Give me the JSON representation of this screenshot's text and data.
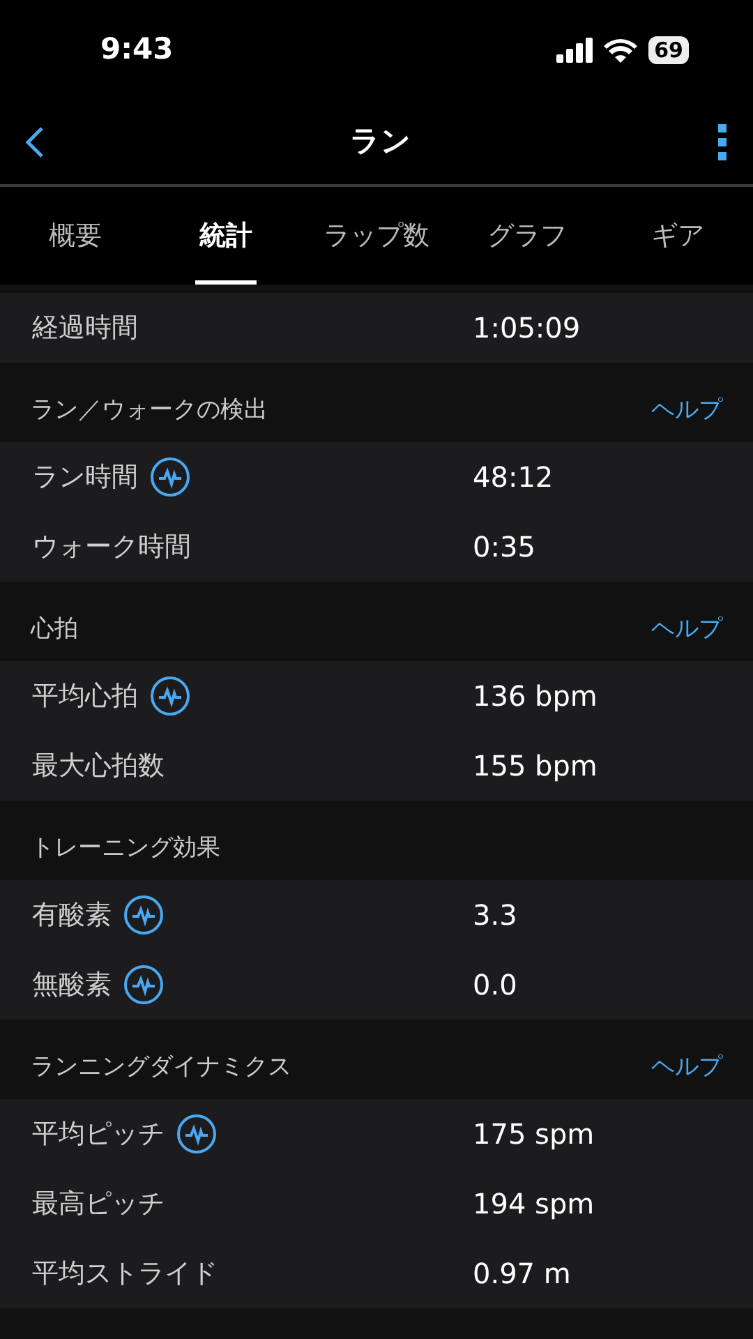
{
  "status_bar": {
    "time": "9:43",
    "battery": "69"
  },
  "nav": {
    "title": "ラン"
  },
  "tabs": [
    {
      "label": "概要",
      "selected": false
    },
    {
      "label": "統計",
      "selected": true
    },
    {
      "label": "ラップ数",
      "selected": false
    },
    {
      "label": "グラフ",
      "selected": false
    },
    {
      "label": "ギア",
      "selected": false
    }
  ],
  "sections": [
    {
      "rows": [
        {
          "label": "経過時間",
          "value": "1:05:09",
          "chart": false
        }
      ]
    },
    {
      "header": "ラン／ウォークの検出",
      "help": "ヘルプ",
      "rows": [
        {
          "label": "ラン時間",
          "value": "48:12",
          "chart": true
        },
        {
          "label": "ウォーク時間",
          "value": "0:35",
          "chart": false
        }
      ]
    },
    {
      "header": "心拍",
      "help": "ヘルプ",
      "rows": [
        {
          "label": "平均心拍",
          "value": "136 bpm",
          "chart": true
        },
        {
          "label": "最大心拍数",
          "value": "155 bpm",
          "chart": false
        }
      ]
    },
    {
      "header": "トレーニング効果",
      "rows": [
        {
          "label": "有酸素",
          "value": "3.3",
          "chart": true
        },
        {
          "label": "無酸素",
          "value": "0.0",
          "chart": true
        }
      ]
    },
    {
      "header": "ランニングダイナミクス",
      "help": "ヘルプ",
      "rows": [
        {
          "label": "平均ピッチ",
          "value": "175 spm",
          "chart": true
        },
        {
          "label": "最高ピッチ",
          "value": "194 spm",
          "chart": false
        },
        {
          "label": "平均ストライド",
          "value": "0.97 m",
          "chart": false
        }
      ]
    }
  ]
}
